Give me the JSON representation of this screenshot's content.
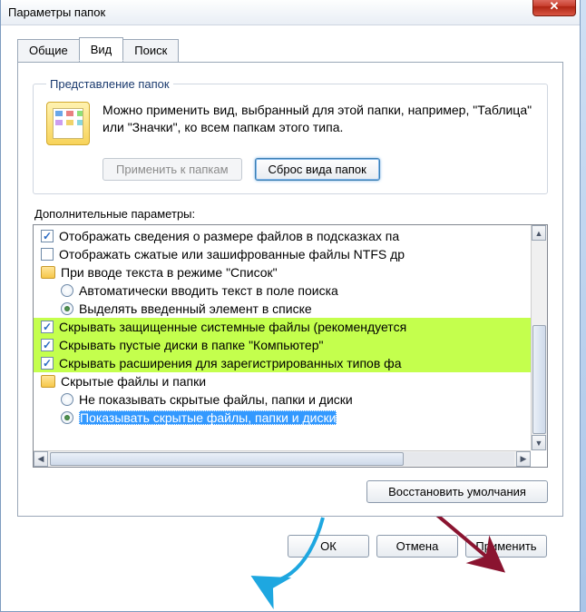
{
  "window": {
    "title": "Параметры папок"
  },
  "tabs": {
    "general": "Общие",
    "view": "Вид",
    "search": "Поиск"
  },
  "folderViews": {
    "legend": "Представление папок",
    "description": "Можно применить вид, выбранный для этой папки, например, \"Таблица\" или \"Значки\", ко всем папкам этого типа.",
    "apply": "Применить к папкам",
    "reset": "Сброс вида папок"
  },
  "advanced": {
    "label": "Дополнительные параметры:",
    "items": {
      "sizeInfoTooltip": "Отображать сведения о размере файлов в подсказках па",
      "showCompressedNtfs": "Отображать сжатые или зашифрованные файлы NTFS др",
      "typingListMode": "При вводе текста в режиме \"Список\"",
      "autoTypeSearch": "Автоматически вводить текст в поле поиска",
      "selectTypedItem": "Выделять введенный элемент в списке",
      "hideProtectedOs": "Скрывать защищенные системные файлы (рекомендуется",
      "hideEmptyDrives": "Скрывать пустые диски в папке \"Компьютер\"",
      "hideKnownExt": "Скрывать расширения для зарегистрированных типов фа",
      "hiddenFilesGroup": "Скрытые файлы и папки",
      "dontShowHidden": "Не показывать скрытые файлы, папки и диски",
      "showHidden": "Показывать скрытые файлы, папки и диски"
    },
    "restoreDefaults": "Восстановить умолчания"
  },
  "buttons": {
    "ok": "ОК",
    "cancel": "Отмена",
    "apply": "Применить"
  }
}
